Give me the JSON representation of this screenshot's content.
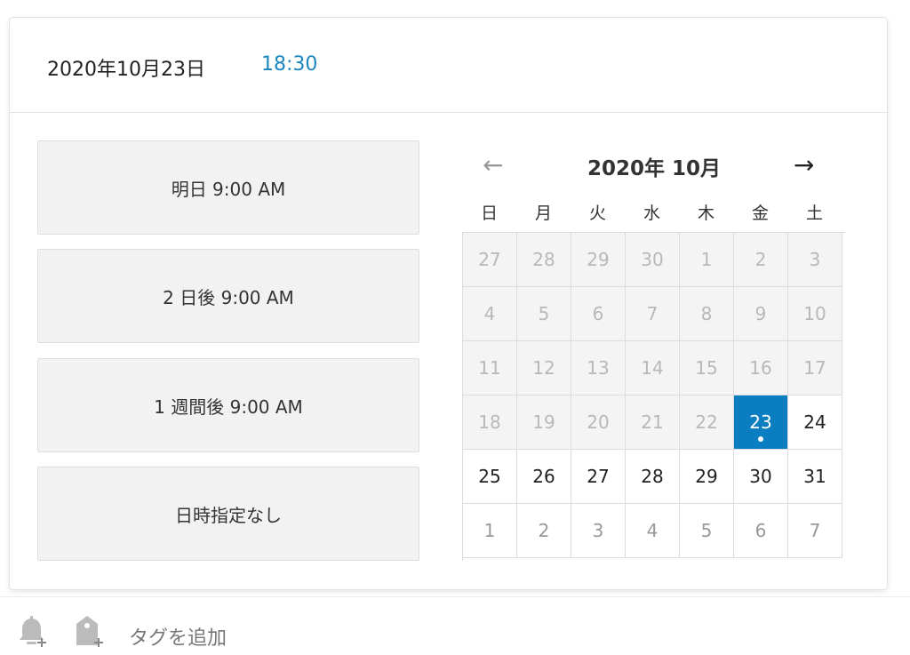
{
  "header": {
    "date": "2020年10月23日",
    "time": "18:30"
  },
  "quick_options": [
    "明日 9:00 AM",
    "2 日後 9:00 AM",
    "1 週間後 9:00 AM",
    "日時指定なし"
  ],
  "calendar": {
    "title": "2020年 10月",
    "prev_icon": "arrow-left-icon",
    "next_icon": "arrow-right-icon",
    "weekdays": [
      "日",
      "月",
      "火",
      "水",
      "木",
      "金",
      "土"
    ],
    "selected": "23",
    "weeks": [
      [
        "27",
        "28",
        "29",
        "30",
        "1",
        "2",
        "3"
      ],
      [
        "4",
        "5",
        "6",
        "7",
        "8",
        "9",
        "10"
      ],
      [
        "11",
        "12",
        "13",
        "14",
        "15",
        "16",
        "17"
      ],
      [
        "18",
        "19",
        "20",
        "21",
        "22",
        "23",
        "24"
      ],
      [
        "25",
        "26",
        "27",
        "28",
        "29",
        "30",
        "31"
      ],
      [
        "1",
        "2",
        "3",
        "4",
        "5",
        "6",
        "7"
      ]
    ]
  },
  "footer": {
    "reminder_icon": "bell-plus-icon",
    "tag_icon": "tag-plus-icon",
    "tag_add_label": "タグを追加"
  },
  "colors": {
    "accent": "#0a7ec1",
    "time_text": "#1b86bf"
  }
}
